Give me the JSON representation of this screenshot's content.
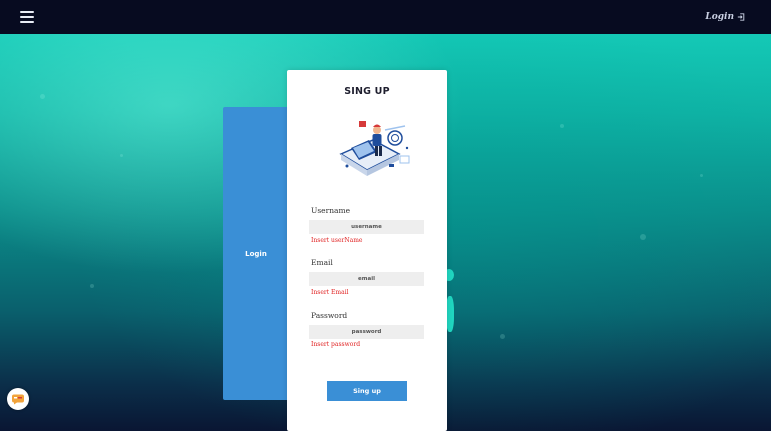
{
  "header": {
    "menu_icon": "hamburger-menu-icon",
    "login_label": "Login",
    "login_icon": "sign-in-icon"
  },
  "side_panel": {
    "button_label": "Login"
  },
  "form": {
    "title": "SING UP",
    "illustration": "person-at-laptop-illustration",
    "username": {
      "label": "Username",
      "placeholder": "username",
      "error": "Insert userName"
    },
    "email": {
      "label": "Email",
      "placeholder": "email",
      "error": "Insert Email"
    },
    "password": {
      "label": "Password",
      "placeholder": "password",
      "error": "Insert password"
    },
    "submit_label": "Sing up"
  },
  "chat_widget": {
    "icon": "chat-icon"
  },
  "colors": {
    "accent": "#3a8fd6",
    "topbar": "#070b20",
    "error": "#e02020",
    "background_top": "#14c9b6",
    "background_bottom": "#0a1633"
  }
}
